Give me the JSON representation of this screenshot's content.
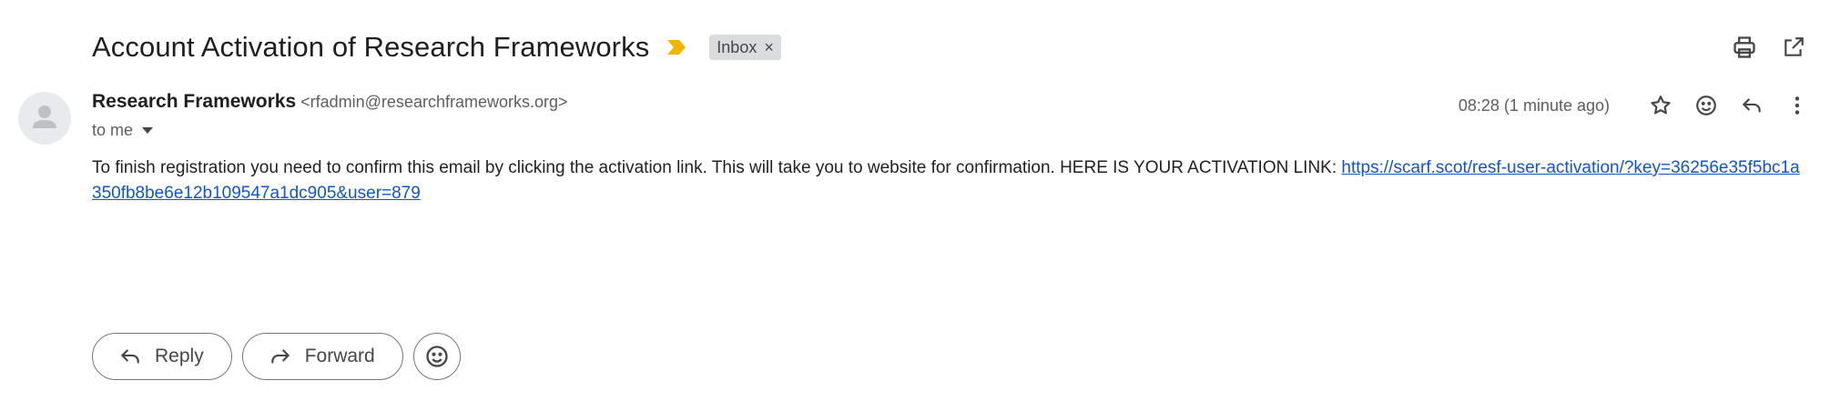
{
  "subject": "Account Activation of Research Frameworks",
  "label": {
    "text": "Inbox",
    "remove": "×"
  },
  "colors": {
    "importance": "#f2b600",
    "link": "#1155cc",
    "chip": "#dadce0"
  },
  "icons": {
    "top": [
      "print-icon",
      "open-in-new-window-icon"
    ],
    "meta": [
      "star-icon",
      "emoji-reaction-icon",
      "reply-icon",
      "more-vert-icon"
    ]
  },
  "sender": {
    "name": "Research Frameworks",
    "email": "<rfadmin@researchframeworks.org>",
    "to": "to me"
  },
  "timestamp": "08:28 (1 minute ago)",
  "body": {
    "text": "To finish registration you need to confirm this email by clicking the activation link. This will take you to website for confirmation. HERE IS YOUR ACTIVATION LINK: ",
    "link": "https://scarf.scot/resf-user-activation/?key=36256e35f5bc1a350fb8be6e12b109547a1dc905&user=879"
  },
  "actions": {
    "reply": "Reply",
    "forward": "Forward"
  }
}
